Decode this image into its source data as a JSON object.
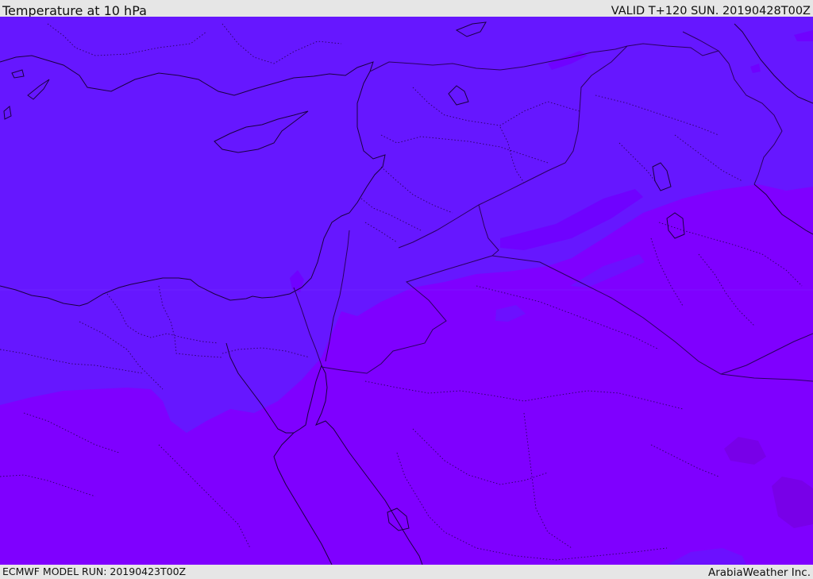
{
  "header": {
    "title": "Temperature at 10 hPa",
    "valid": "VALID T+120 SUN. 20190428T00Z"
  },
  "footer": {
    "model_run": "ECMWF MODEL RUN: 20190423T00Z",
    "credit": "ArabiaWeather Inc."
  },
  "map": {
    "region": "Eastern Mediterranean / Middle East",
    "colors": {
      "cold_zone": "#6617ff",
      "warm_zone": "#7f00ff",
      "warmest_patch": "#7800e8",
      "cool_patch": "#6c10ff",
      "coast": "#1a0040",
      "border": "#2a0060"
    }
  }
}
